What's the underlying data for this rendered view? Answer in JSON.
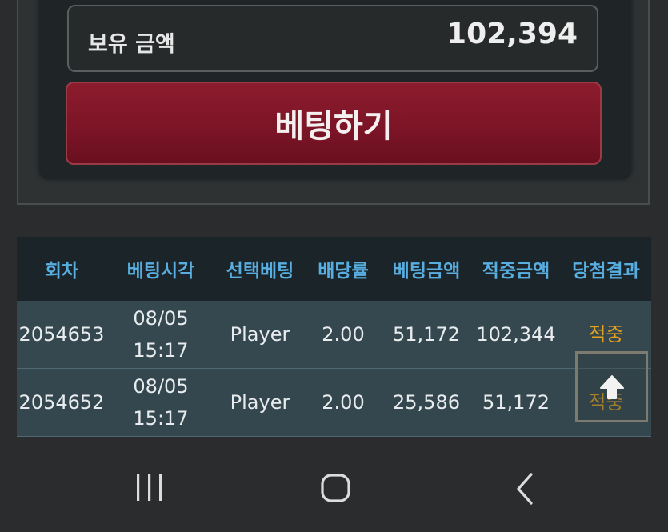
{
  "balance": {
    "label": "보유 금액",
    "value": "102,394"
  },
  "bet_button": {
    "label": "베팅하기"
  },
  "history_table": {
    "columns": [
      "회차",
      "베팅시각",
      "선택베팅",
      "배당률",
      "베팅금액",
      "적중금액",
      "당첨결과"
    ],
    "rows": [
      {
        "round": "2054653",
        "date": "08/05",
        "time": "15:17",
        "pick": "Player",
        "odds": "2.00",
        "bet_amount": "51,172",
        "win_amount": "102,344",
        "result": "적중"
      },
      {
        "round": "2054652",
        "date": "08/05",
        "time": "15:17",
        "pick": "Player",
        "odds": "2.00",
        "bet_amount": "25,586",
        "win_amount": "51,172",
        "result": "적중"
      }
    ]
  },
  "scroll_top": {
    "icon": "arrow-up-icon"
  },
  "nav_bar": {
    "recent_icon": "recent-apps-icon",
    "home_icon": "home-icon",
    "back_icon": "back-icon"
  },
  "colors": {
    "accent_button": "#7a1426",
    "header_text": "#58aee0",
    "win_text": "#e3a320"
  }
}
